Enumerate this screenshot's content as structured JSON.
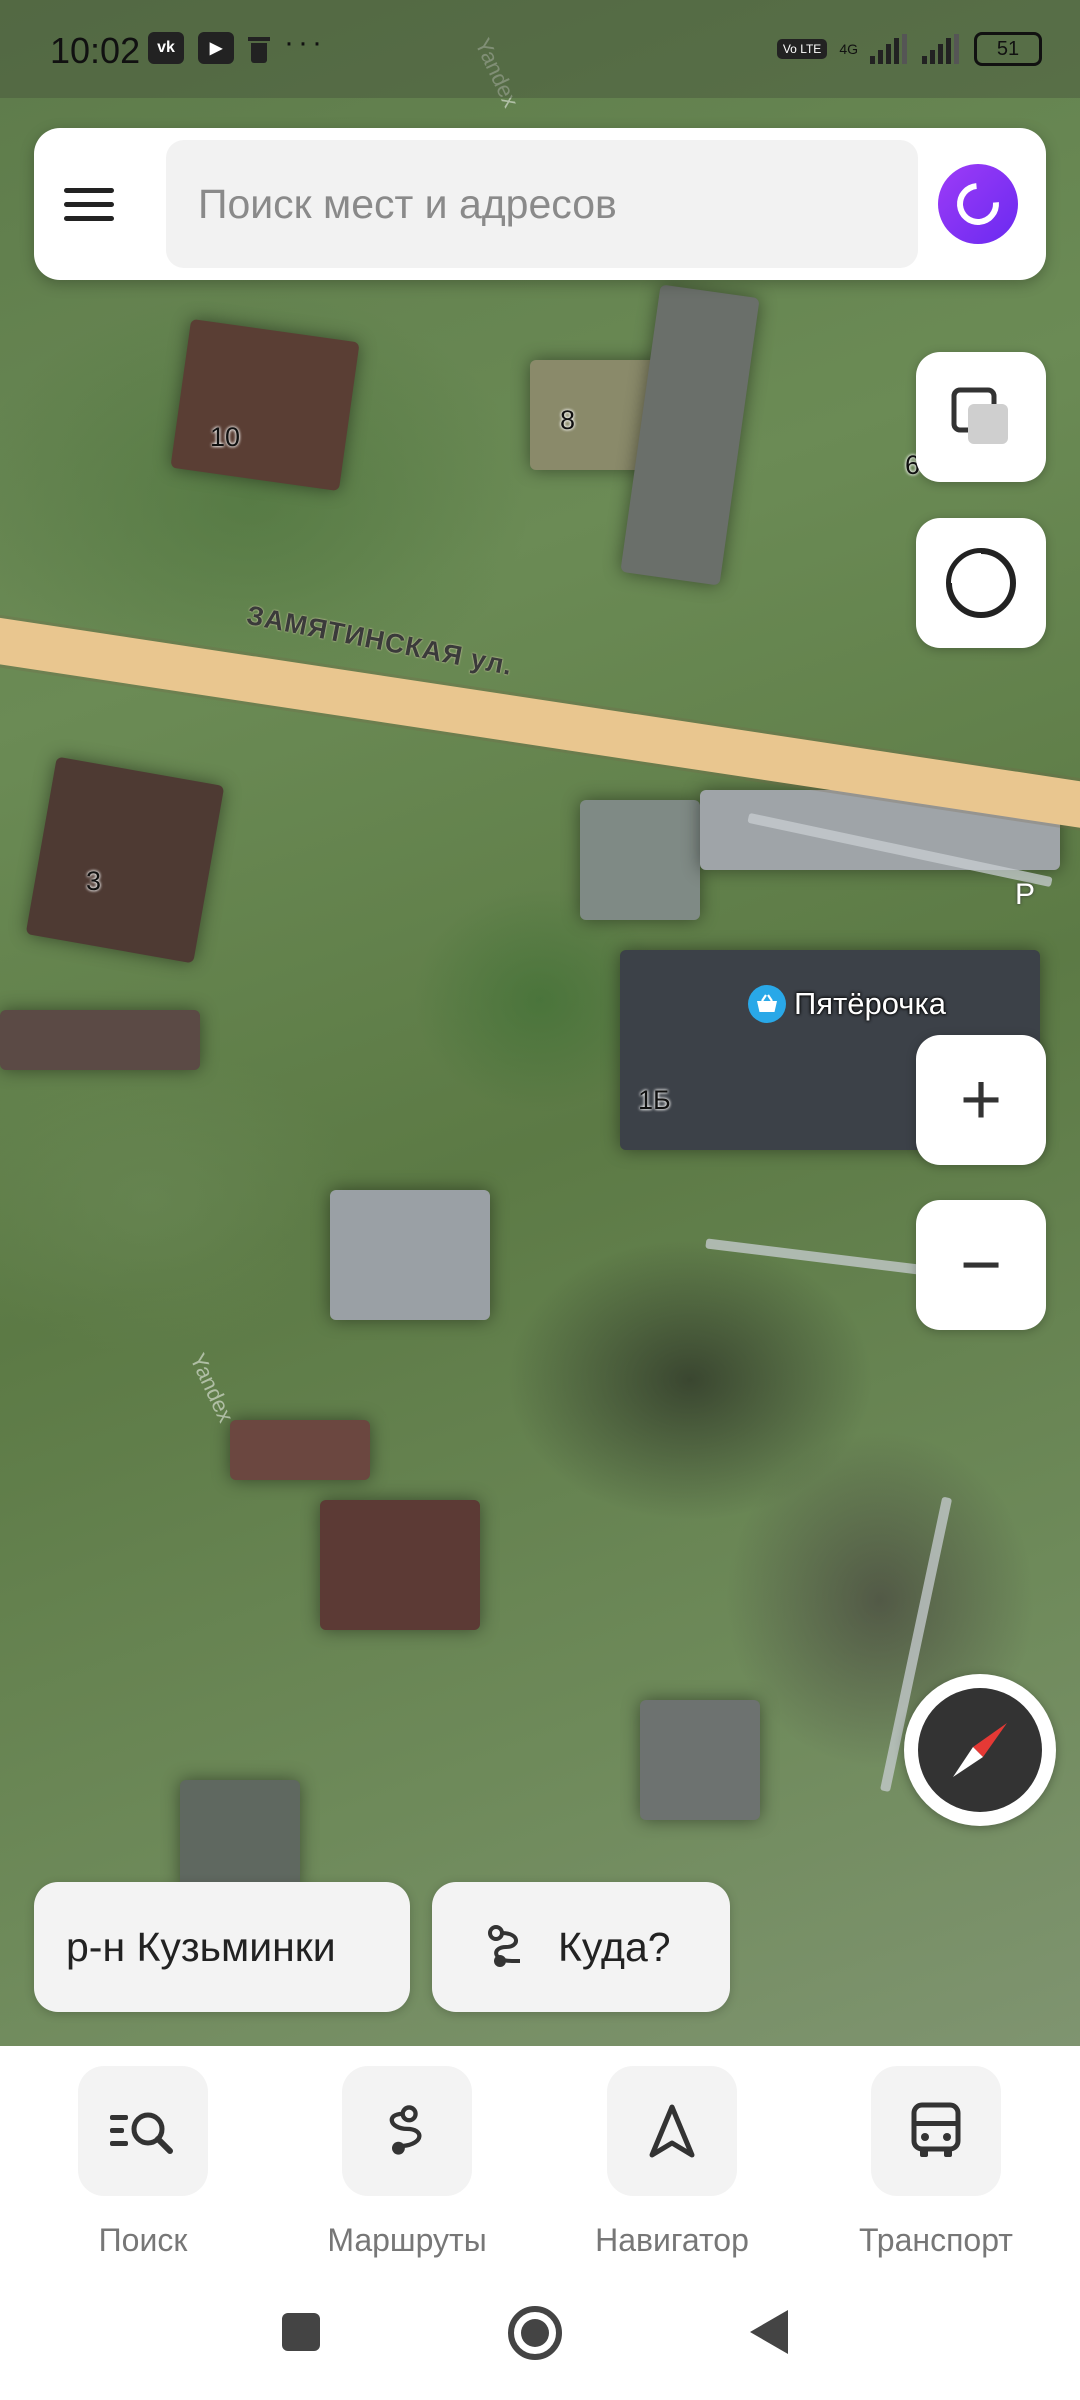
{
  "status_bar": {
    "time": "10:02",
    "left_icons": [
      "vk-icon",
      "youtube-icon",
      "trash-icon"
    ],
    "more": "···",
    "volte": "Vo LTE",
    "network": "4G",
    "battery": "51"
  },
  "search": {
    "placeholder": "Поиск мест и адресов"
  },
  "map": {
    "street_name": "ЗАМЯТИНСКАЯ ул.",
    "house_numbers": [
      "10",
      "8",
      "6",
      "3",
      "1Б"
    ],
    "poi_name": "Пятёрочка",
    "parking_label": "P",
    "watermark": "Yandex"
  },
  "controls": {
    "layers": "layers-icon",
    "alice_route": "circle-icon",
    "zoom_in": "+",
    "zoom_out": "−",
    "compass": "compass-icon"
  },
  "chips": {
    "district": "р-н Кузьминки",
    "where": "Куда?"
  },
  "tabs": [
    {
      "label": "Поиск",
      "icon": "search-list-icon"
    },
    {
      "label": "Маршруты",
      "icon": "route-icon"
    },
    {
      "label": "Навигатор",
      "icon": "navigator-arrow-icon"
    },
    {
      "label": "Транспорт",
      "icon": "bus-icon"
    }
  ],
  "system_nav": [
    "recents-square-icon",
    "home-circle-icon",
    "back-triangle-icon"
  ],
  "colors": {
    "road": "#e9c68f",
    "alice_gradient": "#8a35f5",
    "poi": "#29a8e8",
    "compass_red": "#e53935"
  }
}
